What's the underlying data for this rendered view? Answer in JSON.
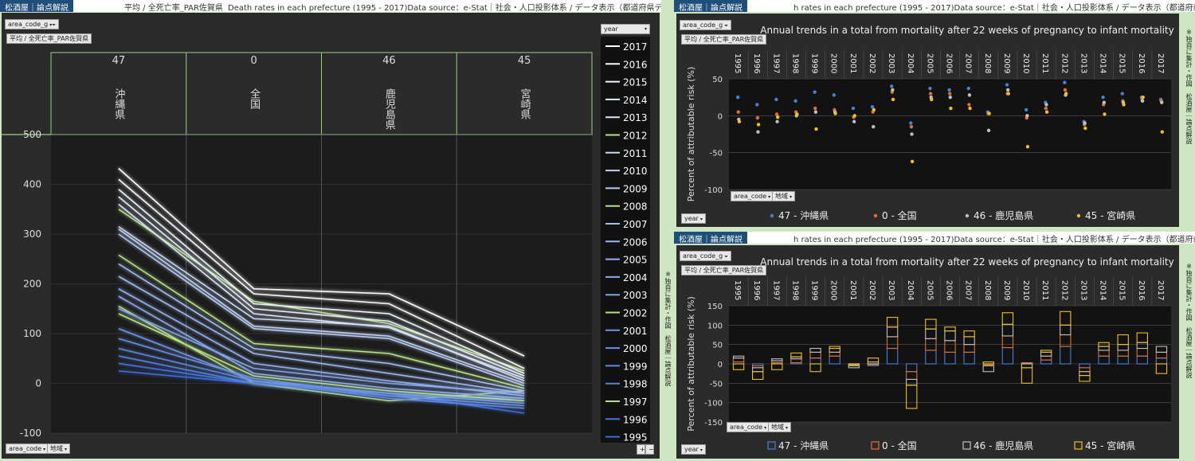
{
  "app": {
    "tag": "松酒屋｜論点解説"
  },
  "left": {
    "header_avg": "平均 / 全死亡率_PAR佐賀県",
    "header_title": "Death rates in each prefecture (1995 - 2017)Data source：e-Stat｜社会・人口投影体系 / データ表示（都道府県データ）",
    "filter_chip": "area_code_g",
    "measure_chip": "平均 / 全死亡率_PAR佐賀県",
    "legend_chip": "year",
    "bottom_chip1": "area_code",
    "bottom_chip2": "地域",
    "zoom_plus": "+",
    "zoom_minus": "−"
  },
  "right_top": {
    "header_title": "h rates in each prefecture (1995 - 2017)Data source：e-Stat｜社会・人口投影体系 / データ表示（都道府県データ）",
    "filter_chip": "area_code_g",
    "measure_chip": "平均 / 全死亡率_PAR佐賀県",
    "chip_area": "area_code",
    "chip_region": "地域",
    "chip_year": "year",
    "side_label_right": "※独自に集計・作図　松酒屋｜論点解説"
  },
  "right_bottom": {
    "header_title": "h rates in each prefecture (1995 - 2017)Data source：e-Stat｜社会・人口投影体系 / データ表示（都道府県データ）",
    "filter_chip": "area_code_g",
    "measure_chip": "平均 / 全死亡率_PAR佐賀県",
    "chip_area": "area_code",
    "chip_region": "地域",
    "chip_year": "year",
    "side_label_right": "※独自に集計・作図　松酒屋｜論点解説"
  },
  "side_label_middle": "※独自に集計・作図　松酒屋｜論点解説",
  "colors": {
    "okinawa": "#4a7fd6",
    "zenkoku": "#e07030",
    "kagoshima": "#c0c0c0",
    "miyazaki": "#f0c020",
    "bg": "#1a1a1a"
  },
  "chart_data": [
    {
      "type": "line",
      "categories": [
        {
          "code": "47",
          "name": "沖縄県"
        },
        {
          "code": "0",
          "name": "全国"
        },
        {
          "code": "46",
          "name": "鹿児島県"
        },
        {
          "code": "45",
          "name": "宮崎県"
        }
      ],
      "ylim": [
        -100,
        500
      ],
      "yticks": [
        -100,
        0,
        100,
        200,
        300,
        400,
        500
      ],
      "legend_title": "year",
      "legend_position": "right",
      "series": [
        {
          "name": "2017",
          "values": [
            432,
            190,
            180,
            55
          ]
        },
        {
          "name": "2016",
          "values": [
            410,
            180,
            160,
            30
          ]
        },
        {
          "name": "2015",
          "values": [
            390,
            160,
            140,
            20
          ]
        },
        {
          "name": "2014",
          "values": [
            375,
            150,
            125,
            15
          ]
        },
        {
          "name": "2013",
          "values": [
            360,
            140,
            112,
            10
          ]
        },
        {
          "name": "2012",
          "values": [
            350,
            165,
            120,
            25
          ]
        },
        {
          "name": "2011",
          "values": [
            315,
            130,
            115,
            5
          ]
        },
        {
          "name": "2010",
          "values": [
            310,
            115,
            95,
            0
          ]
        },
        {
          "name": "2009",
          "values": [
            300,
            110,
            90,
            -5
          ]
        },
        {
          "name": "2008",
          "values": [
            258,
            80,
            60,
            -10
          ]
        },
        {
          "name": "2007",
          "values": [
            240,
            70,
            40,
            -15
          ]
        },
        {
          "name": "2006",
          "values": [
            215,
            60,
            20,
            -20
          ]
        },
        {
          "name": "2005",
          "values": [
            190,
            40,
            5,
            -25
          ]
        },
        {
          "name": "2004",
          "values": [
            175,
            20,
            -10,
            -30
          ]
        },
        {
          "name": "2003",
          "values": [
            150,
            30,
            0,
            -20
          ]
        },
        {
          "name": "2002",
          "values": [
            140,
            15,
            -15,
            -35
          ]
        },
        {
          "name": "2001",
          "values": [
            110,
            5,
            -20,
            -40
          ]
        },
        {
          "name": "2000",
          "values": [
            90,
            10,
            -25,
            -45
          ]
        },
        {
          "name": "1999",
          "values": [
            70,
            5,
            -30,
            -50
          ]
        },
        {
          "name": "1998",
          "values": [
            55,
            0,
            -25,
            -30
          ]
        },
        {
          "name": "1997",
          "values": [
            155,
            0,
            -35,
            -15
          ]
        },
        {
          "name": "1996",
          "values": [
            40,
            0,
            -20,
            -35
          ]
        },
        {
          "name": "1995",
          "values": [
            25,
            0,
            -20,
            -60
          ]
        }
      ]
    },
    {
      "type": "scatter",
      "title": "Annual trends in a total from mortality after 22 weeks of pregnancy to infant mortality",
      "ylabel": "Percent of attributable risk (%)",
      "ylim": [
        -100,
        50
      ],
      "yticks": [
        -100,
        -50,
        0,
        50
      ],
      "categories": [
        "1995",
        "1996",
        "1997",
        "1998",
        "1999",
        "2000",
        "2001",
        "2002",
        "2003",
        "2004",
        "2005",
        "2006",
        "2007",
        "2008",
        "2009",
        "2010",
        "2011",
        "2012",
        "2013",
        "2014",
        "2015",
        "2016",
        "2017"
      ],
      "legend_position": "bottom",
      "series": [
        {
          "name": "47 - 沖縄県",
          "values": [
            25,
            15,
            22,
            20,
            32,
            28,
            10,
            12,
            40,
            -10,
            37,
            35,
            37,
            5,
            42,
            8,
            18,
            45,
            -8,
            25,
            30,
            25,
            22
          ]
        },
        {
          "name": "0 - 全国",
          "values": [
            5,
            -3,
            2,
            5,
            10,
            8,
            -2,
            5,
            32,
            -15,
            30,
            30,
            15,
            3,
            30,
            -3,
            10,
            35,
            -12,
            15,
            20,
            22,
            20
          ]
        },
        {
          "name": "46 - 鹿児島県",
          "values": [
            -5,
            -22,
            -8,
            0,
            5,
            5,
            -8,
            -15,
            35,
            -25,
            25,
            25,
            28,
            -20,
            35,
            0,
            15,
            28,
            -10,
            18,
            18,
            20,
            18
          ]
        },
        {
          "name": "45 - 宮崎県",
          "values": [
            -8,
            -12,
            -2,
            2,
            -18,
            3,
            0,
            8,
            22,
            -62,
            22,
            10,
            10,
            3,
            30,
            -42,
            5,
            30,
            -17,
            2,
            15,
            25,
            -22
          ]
        }
      ]
    },
    {
      "type": "bar",
      "title": "Annual trends in a total from mortality after 22 weeks of pregnancy to infant mortality",
      "ylabel": "Percent of attributable risk (%)",
      "ylim": [
        -150,
        150
      ],
      "yticks": [
        -150,
        -100,
        -50,
        0,
        50,
        100,
        150
      ],
      "stacked": true,
      "categories": [
        "1995",
        "1996",
        "1997",
        "1998",
        "1999",
        "2000",
        "2001",
        "2002",
        "2003",
        "2004",
        "2005",
        "2006",
        "2007",
        "2008",
        "2009",
        "2010",
        "2011",
        "2012",
        "2013",
        "2014",
        "2015",
        "2016",
        "2017"
      ],
      "legend_position": "bottom",
      "series": [
        {
          "name": "47 - 沖縄県",
          "values": [
            5,
            -5,
            3,
            3,
            15,
            20,
            -5,
            -5,
            40,
            -20,
            35,
            30,
            30,
            -5,
            42,
            3,
            10,
            45,
            -10,
            20,
            20,
            20,
            15
          ]
        },
        {
          "name": "0 - 全国",
          "values": [
            10,
            -5,
            5,
            10,
            15,
            10,
            0,
            0,
            30,
            -20,
            30,
            30,
            20,
            0,
            30,
            0,
            10,
            30,
            -10,
            15,
            15,
            20,
            15
          ]
        },
        {
          "name": "46 - 鹿児島県",
          "values": [
            5,
            -10,
            5,
            5,
            10,
            10,
            -5,
            5,
            25,
            -15,
            25,
            25,
            20,
            -15,
            30,
            -10,
            10,
            25,
            -10,
            10,
            15,
            15,
            15
          ]
        },
        {
          "name": "45 - 宮崎県",
          "values": [
            -15,
            -20,
            -15,
            10,
            -20,
            5,
            0,
            10,
            25,
            -60,
            25,
            10,
            15,
            5,
            30,
            -40,
            5,
            35,
            -15,
            10,
            25,
            25,
            -25
          ]
        }
      ]
    }
  ]
}
